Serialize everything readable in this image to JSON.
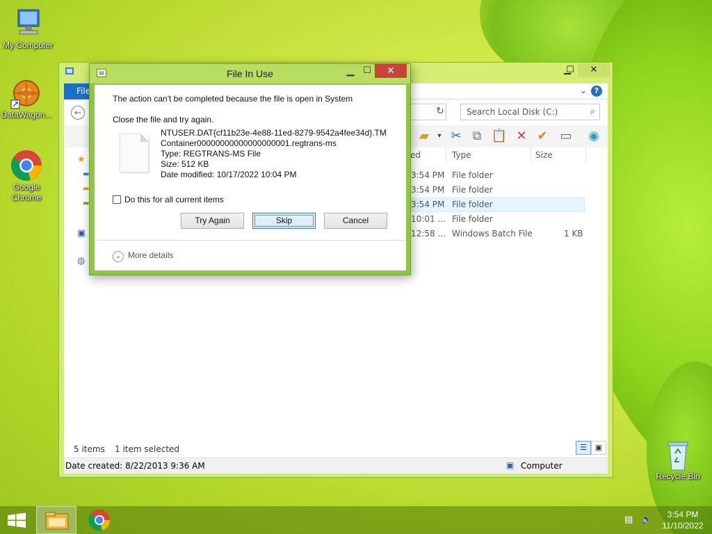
{
  "desktop": {
    "icons": [
      {
        "label": "My Computer"
      },
      {
        "label": "DataWagon..."
      },
      {
        "label": "Google Chrome"
      },
      {
        "label": "Recycle Bin"
      }
    ]
  },
  "explorer": {
    "ribbon_file_tab": "File",
    "search_placeholder": "Search Local Disk (C:)",
    "columns": {
      "modified": "ed",
      "type": "Type",
      "size": "Size"
    },
    "rows": [
      {
        "modified": "3:54 PM",
        "type": "File folder",
        "size": ""
      },
      {
        "modified": "3:54 PM",
        "type": "File folder",
        "size": ""
      },
      {
        "modified": "3:54 PM",
        "type": "File folder",
        "size": "",
        "selected": true
      },
      {
        "modified": "10:01 ...",
        "type": "File folder",
        "size": ""
      },
      {
        "modified": "12:58 ...",
        "type": "Windows Batch File",
        "size": "1 KB"
      }
    ],
    "status": {
      "items": "5 items",
      "selected": "1 item selected"
    },
    "details_bar": {
      "date_created": "Date created: 8/22/2013 9:36 AM",
      "location": "Computer"
    }
  },
  "dialog": {
    "title": "File In Use",
    "message": "The action can't be completed because the file is open in System",
    "hint": "Close the file and try again.",
    "file": {
      "name": "NTUSER.DAT{cf11b23e-4e88-11ed-8279-9542a4fee34d}.TMContainer00000000000000000001.regtrans-ms",
      "type": "Type: REGTRANS-MS File",
      "size": "Size: 512 KB",
      "modified": "Date modified: 10/17/2022 10:04 PM"
    },
    "checkbox_label": "Do this for all current items",
    "buttons": {
      "try_again": "Try Again",
      "skip": "Skip",
      "cancel": "Cancel"
    },
    "more_details": "More details"
  },
  "taskbar": {
    "clock_time": "3:54 PM",
    "clock_date": "11/10/2022"
  },
  "colors": {
    "accent": "#1c6fc7",
    "dialog_frame": "#8ec63f",
    "close_button": "#c7443b"
  }
}
